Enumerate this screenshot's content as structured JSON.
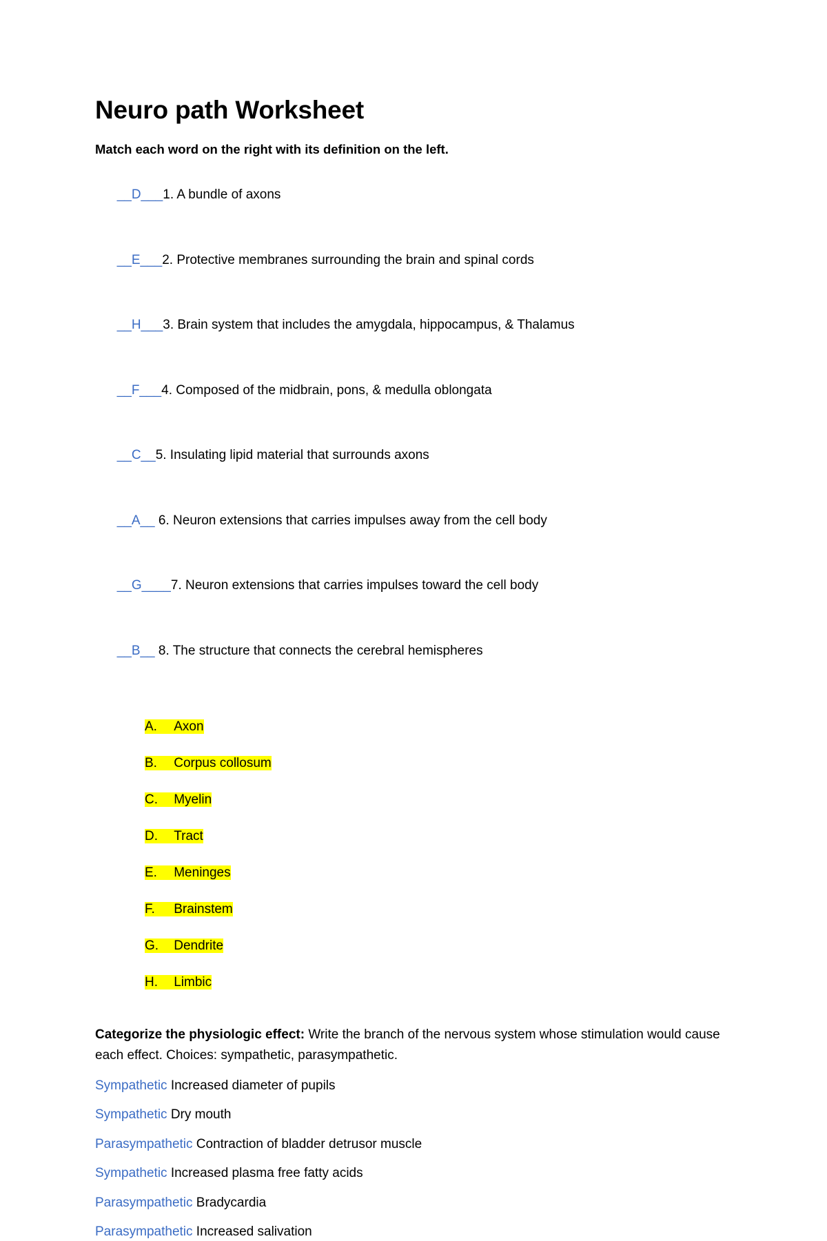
{
  "document": {
    "title": "Neuro path Worksheet",
    "colors": {
      "answer_blue": "#3b6cc4",
      "highlight_yellow": "#ffff00",
      "text_black": "#000000",
      "page_background": "#ffffff"
    }
  },
  "matching_section": {
    "instruction": "Match each word on the right with its definition on the left.",
    "items": [
      {
        "blank": "__D___",
        "answer_letter": "D",
        "number": "1.",
        "definition": "1. A bundle of axons"
      },
      {
        "blank": "__E___",
        "answer_letter": "E",
        "number": "2.",
        "definition": "2. Protective membranes surrounding the brain and spinal cords"
      },
      {
        "blank": "__H___",
        "answer_letter": "H",
        "number": "3.",
        "definition": "3. Brain system that includes the amygdala, hippocampus, & Thalamus"
      },
      {
        "blank": "__F___",
        "answer_letter": "F",
        "number": "4.",
        "definition": "4. Composed of the midbrain, pons, & medulla oblongata"
      },
      {
        "blank": "__C__",
        "answer_letter": "C",
        "number": "5.",
        "definition": "5. Insulating lipid material that surrounds axons"
      },
      {
        "blank": "__A__",
        "answer_letter": "A",
        "number": "6.",
        "definition": " 6. Neuron extensions that carries impulses away from the cell body"
      },
      {
        "blank": "__G____",
        "answer_letter": "G",
        "number": "7.",
        "definition": "7. Neuron extensions that carries impulses toward the cell body"
      },
      {
        "blank": "__B__",
        "answer_letter": "B",
        "number": "8.",
        "definition": " 8. The structure that connects the cerebral hemispheres"
      }
    ]
  },
  "word_bank": {
    "items": [
      {
        "label": "A.",
        "term": "Axon",
        "text": "A.\tAxon"
      },
      {
        "label": "B.",
        "term": "Corpus collosum",
        "text": "B.\tCorpus collosum"
      },
      {
        "label": "C.",
        "term": "Myelin",
        "text": "C.\tMyelin"
      },
      {
        "label": "D.",
        "term": "Tract",
        "text": "D.\tTract"
      },
      {
        "label": "E.",
        "term": "Meninges",
        "text": "E.\tMeninges"
      },
      {
        "label": "F.",
        "term": "Brainstem",
        "text": "F.\tBrainstem"
      },
      {
        "label": "G.",
        "term": "Dendrite",
        "text": "G.\tDendrite"
      },
      {
        "label": "H.",
        "term": "Limbic",
        "text": "H.\tLimbic"
      }
    ]
  },
  "categorize_section": {
    "lead": "Categorize the physiologic effect:",
    "prompt": " Write the branch of the nervous system whose stimulation would cause each effect. Choices: sympathetic, parasympathetic.",
    "items": [
      {
        "answer": "Sympathetic",
        "effect": " Increased diameter of pupils"
      },
      {
        "answer": "Sympathetic",
        "effect": " Dry mouth"
      },
      {
        "answer": "Parasympathetic",
        "effect": " Contraction of bladder detrusor muscle"
      },
      {
        "answer": "Sympathetic",
        "effect": " Increased plasma free fatty acids"
      },
      {
        "answer": "Parasympathetic",
        "effect": " Bradycardia"
      },
      {
        "answer": "Parasympathetic",
        "effect": " Increased salivation"
      }
    ]
  }
}
